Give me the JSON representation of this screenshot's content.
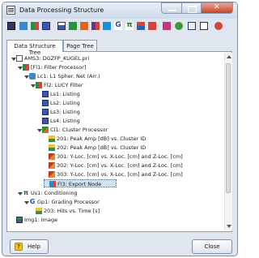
{
  "window": {
    "title": "Data Processing Structure"
  },
  "tabs": [
    {
      "label": "Data Structure Tree",
      "active": true
    },
    {
      "label": "Page Tree",
      "active": false
    }
  ],
  "tree": [
    {
      "text": "AMS3: DGZFP_KUGEL.pri",
      "icon": "document-icon"
    },
    {
      "text": "[Fl1: Filter Processor]",
      "icon": "filter-icon"
    },
    {
      "text": "Lc1: L1 Spher. Net (Arr.)",
      "icon": "location-icon"
    },
    {
      "text": "Fl2: LUCY Filter",
      "icon": "filter-icon"
    },
    {
      "text": "Ls1: Listing",
      "icon": "listing-icon"
    },
    {
      "text": "Ls2: Listing",
      "icon": "listing-icon"
    },
    {
      "text": "Ls3: Listing",
      "icon": "listing-icon"
    },
    {
      "text": "Ls4: Listing",
      "icon": "listing-icon"
    },
    {
      "text": "Cl1: Cluster Processor",
      "icon": "cluster-icon"
    },
    {
      "text": "201: Peak Amp [dB] vs. Cluster ID",
      "icon": "diagram-2d-icon"
    },
    {
      "text": "202: Peak Amp [dB] vs. Cluster ID",
      "icon": "diagram-2d-icon"
    },
    {
      "text": "301: Y-Loc. [cm] vs. X-Loc. [cm] and Z-Loc. [cm]",
      "icon": "diagram-3d-icon"
    },
    {
      "text": "302: Y-Loc. [cm] vs. X-Loc. [cm] and Z-Loc. [cm]",
      "icon": "diagram-3d-icon"
    },
    {
      "text": "303: Y-Loc. [cm] vs. X-Loc. [cm] and Z-Loc. [cm]",
      "icon": "diagram-3d-icon"
    },
    {
      "text": "Fl3: Export Node",
      "icon": "export-icon"
    },
    {
      "text": "Us1: Conditioning",
      "icon": "conditioning-icon"
    },
    {
      "text": "Gp1: Grading Processor",
      "icon": "grading-icon"
    },
    {
      "text": "203: Hits vs. Time [s]",
      "icon": "diagram-2d-icon"
    },
    {
      "text": "Img1: Image",
      "icon": "image-icon"
    }
  ],
  "buttons": {
    "help": "Help",
    "close": "Close"
  }
}
